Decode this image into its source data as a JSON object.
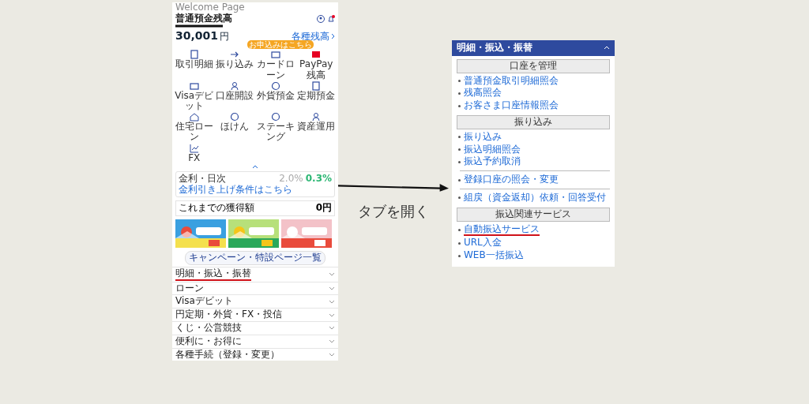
{
  "home_screen": {
    "top_label": "Welcome Page",
    "account_name": "普通預金残高",
    "balance": "30,001",
    "currency": "円",
    "balance_link": "各種残高",
    "shortcuts": [
      {
        "label": "取引明細"
      },
      {
        "label": "振り込み"
      },
      {
        "label": "カードローン",
        "badge": "お申込みはこちら"
      },
      {
        "label": "PayPay残高"
      },
      {
        "label": "Visaデビット"
      },
      {
        "label": "口座開設"
      },
      {
        "label": "外貨預金"
      },
      {
        "label": "定期預金"
      },
      {
        "label": "住宅ローン"
      },
      {
        "label": "ほけん"
      },
      {
        "label": "ステーキング"
      },
      {
        "label": "資産運用"
      },
      {
        "label": "FX"
      }
    ],
    "rate_card": {
      "title": "金利・日次",
      "link": "金利引き上げ条件はこちら",
      "rate_before": "2.0%",
      "rate_after": "0.3%"
    },
    "earned": {
      "label": "これまでの獲得額",
      "value": "0円"
    },
    "campaign_button": "キャンペーン・特設ページ一覧",
    "menu": [
      {
        "label": "明細・振込・振替",
        "underlined": true
      },
      {
        "label": "ローン",
        "underlined": false
      },
      {
        "label": "Visaデビット",
        "underlined": false
      },
      {
        "label": "円定期・外貨・FX・投信",
        "underlined": false
      },
      {
        "label": "くじ・公営競技",
        "underlined": false
      },
      {
        "label": "便利に・お得に",
        "underlined": false
      },
      {
        "label": "各種手続（登録・変更）",
        "underlined": false
      }
    ]
  },
  "arrow_caption": "タブを開く",
  "menu_panel": {
    "title": "明細・振込・振替",
    "expanded": true,
    "items": [
      {
        "kind": "section",
        "label": "口座を管理"
      },
      {
        "kind": "link",
        "label": "普通預金取引明細照会",
        "underlined": false
      },
      {
        "kind": "link",
        "label": "残高照会",
        "underlined": false
      },
      {
        "kind": "link",
        "label": "お客さま口座情報照会",
        "underlined": false
      },
      {
        "kind": "section",
        "label": "振り込み"
      },
      {
        "kind": "link",
        "label": "振り込み",
        "underlined": false
      },
      {
        "kind": "link",
        "label": "振込明細照会",
        "underlined": false
      },
      {
        "kind": "link",
        "label": "振込予約取消",
        "underlined": false
      },
      {
        "kind": "divider"
      },
      {
        "kind": "link",
        "label": "登録口座の照会・変更",
        "underlined": false
      },
      {
        "kind": "divider"
      },
      {
        "kind": "link",
        "label": "組戻（資金返却）依頼・回答受付",
        "underlined": false
      },
      {
        "kind": "section",
        "label": "振込関連サービス"
      },
      {
        "kind": "link",
        "label": "自動振込サービス",
        "underlined": true
      },
      {
        "kind": "link",
        "label": "URL入金",
        "underlined": false
      },
      {
        "kind": "link",
        "label": "WEB一括振込",
        "underlined": false
      }
    ]
  }
}
